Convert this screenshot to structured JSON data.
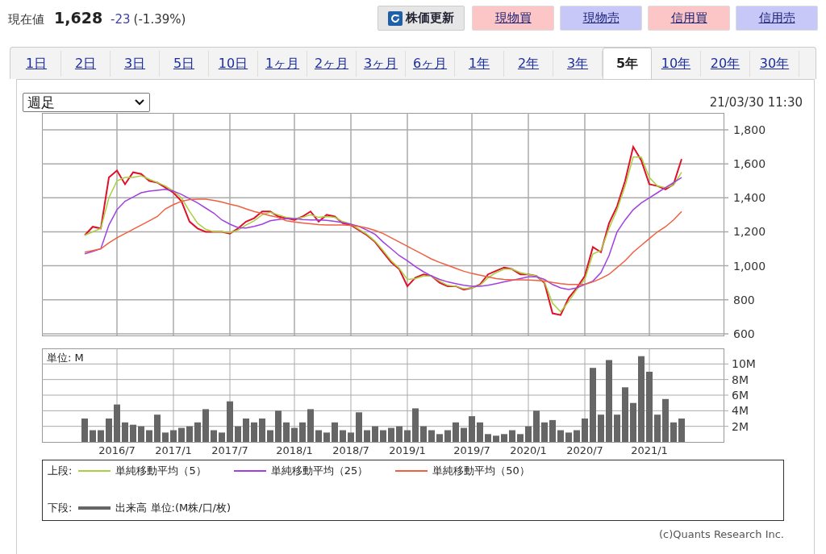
{
  "quote": {
    "label": "現在値",
    "price": "1,628",
    "change": "-23",
    "change_pct": "(-1.39%)"
  },
  "buttons": [
    {
      "label": "株価更新",
      "kind": "refresh",
      "color": "#e6e6e6"
    },
    {
      "label": "現物買",
      "kind": "order",
      "color": "#fdc6c6"
    },
    {
      "label": "現物売",
      "kind": "order",
      "color": "#c8c8f8"
    },
    {
      "label": "信用買",
      "kind": "order",
      "color": "#fdc6c6"
    },
    {
      "label": "信用売",
      "kind": "order",
      "color": "#c8c8f8"
    }
  ],
  "tabs": [
    {
      "label": "1日",
      "selected": false
    },
    {
      "label": "2日",
      "selected": false
    },
    {
      "label": "3日",
      "selected": false
    },
    {
      "label": "5日",
      "selected": false
    },
    {
      "label": "10日",
      "selected": false
    },
    {
      "label": "1ヶ月",
      "selected": false
    },
    {
      "label": "2ヶ月",
      "selected": false
    },
    {
      "label": "3ヶ月",
      "selected": false
    },
    {
      "label": "6ヶ月",
      "selected": false
    },
    {
      "label": "1年",
      "selected": false
    },
    {
      "label": "2年",
      "selected": false
    },
    {
      "label": "3年",
      "selected": false
    },
    {
      "label": "5年",
      "selected": true
    },
    {
      "label": "10年",
      "selected": false
    },
    {
      "label": "20年",
      "selected": false
    },
    {
      "label": "30年",
      "selected": false
    }
  ],
  "chart_panel": {
    "interval": {
      "value": "週足"
    },
    "timestamp": "21/03/30 11:30",
    "price_chart": {
      "chart_data": {
        "type": "line",
        "grid": true,
        "ylim": [
          590,
          1900
        ],
        "yticks": [
          {
            "value": 600,
            "label": "600"
          },
          {
            "value": 800,
            "label": "800"
          },
          {
            "value": 1000,
            "label": "1,000"
          },
          {
            "value": 1200,
            "label": "1,200"
          },
          {
            "value": 1400,
            "label": "1,400"
          },
          {
            "value": 1600,
            "label": "1,600"
          },
          {
            "value": 1800,
            "label": "1,800"
          }
        ],
        "series": [
          {
            "color": "#e0102a",
            "values": [
              1180,
              1230,
              1220,
              1520,
              1560,
              1480,
              1550,
              1540,
              1500,
              1490,
              1460,
              1430,
              1380,
              1260,
              1220,
              1200,
              1200,
              1200,
              1190,
              1220,
              1260,
              1280,
              1320,
              1320,
              1290,
              1280,
              1270,
              1290,
              1320,
              1260,
              1300,
              1290,
              1250,
              1240,
              1210,
              1180,
              1140,
              1080,
              1020,
              980,
              880,
              930,
              950,
              940,
              900,
              880,
              880,
              860,
              870,
              890,
              950,
              970,
              990,
              980,
              950,
              950,
              940,
              900,
              720,
              710,
              810,
              870,
              940,
              1110,
              1080,
              1250,
              1350,
              1500,
              1700,
              1620,
              1480,
              1470,
              1450,
              1480,
              1628
            ]
          },
          {
            "color": "#a8d040",
            "values": [
              1180,
              1200,
              1220,
              1400,
              1500,
              1520,
              1520,
              1530,
              1510,
              1490,
              1470,
              1440,
              1400,
              1320,
              1250,
              1215,
              1200,
              1200,
              1195,
              1210,
              1240,
              1265,
              1300,
              1315,
              1300,
              1285,
              1278,
              1285,
              1300,
              1285,
              1290,
              1285,
              1260,
              1245,
              1215,
              1185,
              1145,
              1090,
              1030,
              985,
              920,
              925,
              940,
              940,
              910,
              885,
              880,
              865,
              870,
              885,
              930,
              960,
              980,
              980,
              960,
              950,
              940,
              905,
              780,
              730,
              790,
              860,
              920,
              1070,
              1090,
              1220,
              1330,
              1470,
              1640,
              1640,
              1520,
              1470,
              1460,
              1475,
              1550
            ]
          },
          {
            "color": "#a040e0",
            "values": [
              1070,
              1085,
              1100,
              1240,
              1330,
              1380,
              1405,
              1430,
              1440,
              1445,
              1450,
              1440,
              1420,
              1395,
              1370,
              1340,
              1310,
              1270,
              1245,
              1225,
              1222,
              1232,
              1245,
              1265,
              1272,
              1278,
              1278,
              1272,
              1270,
              1270,
              1268,
              1262,
              1255,
              1245,
              1232,
              1210,
              1185,
              1140,
              1100,
              1060,
              1030,
              995,
              965,
              940,
              920,
              905,
              895,
              885,
              880,
              880,
              885,
              895,
              905,
              915,
              925,
              935,
              935,
              920,
              890,
              870,
              860,
              870,
              890,
              910,
              960,
              1060,
              1200,
              1270,
              1330,
              1370,
              1400,
              1430,
              1460,
              1490,
              1520
            ]
          },
          {
            "color": "#f06040",
            "values": [
              1080,
              1090,
              1100,
              1135,
              1165,
              1190,
              1215,
              1240,
              1265,
              1290,
              1335,
              1360,
              1380,
              1390,
              1392,
              1392,
              1385,
              1375,
              1362,
              1352,
              1335,
              1320,
              1308,
              1295,
              1285,
              1265,
              1258,
              1252,
              1247,
              1242,
              1240,
              1240,
              1240,
              1238,
              1232,
              1222,
              1208,
              1190,
              1165,
              1140,
              1115,
              1090,
              1065,
              1040,
              1020,
              1003,
              985,
              968,
              955,
              945,
              935,
              925,
              920,
              918,
              918,
              916,
              914,
              910,
              902,
              895,
              890,
              890,
              892,
              905,
              925,
              950,
              990,
              1030,
              1080,
              1120,
              1160,
              1200,
              1230,
              1270,
              1320
            ]
          }
        ]
      }
    },
    "volume_chart": {
      "unit_label": "単位: M",
      "chart_data": {
        "type": "bar",
        "grid": true,
        "ylim": [
          0,
          12
        ],
        "yticks": [
          {
            "value": 2,
            "label": "2M"
          },
          {
            "value": 4,
            "label": "4M"
          },
          {
            "value": 6,
            "label": "6M"
          },
          {
            "value": 8,
            "label": "8M"
          },
          {
            "value": 10,
            "label": "10M"
          }
        ],
        "categories": [
          null,
          null,
          null,
          null,
          "2016/7",
          null,
          null,
          null,
          null,
          null,
          null,
          "2017/1",
          null,
          null,
          null,
          null,
          null,
          null,
          "2017/7",
          null,
          null,
          null,
          null,
          null,
          null,
          null,
          "2018/1",
          null,
          null,
          null,
          null,
          null,
          null,
          "2018/7",
          null,
          null,
          null,
          null,
          null,
          null,
          "2019/1",
          null,
          null,
          null,
          null,
          null,
          null,
          null,
          "2019/7",
          null,
          null,
          null,
          null,
          null,
          null,
          "2020/1",
          null,
          null,
          null,
          null,
          null,
          null,
          "2020/7",
          null,
          null,
          null,
          null,
          null,
          null,
          null,
          "2021/1",
          null,
          null,
          null,
          null
        ],
        "series": [
          {
            "color": "#666666",
            "values": [
              3.0,
              1.5,
              1.5,
              3.0,
              4.8,
              2.5,
              2.2,
              2.0,
              1.5,
              3.5,
              1.2,
              1.5,
              1.8,
              2.0,
              2.5,
              4.2,
              1.5,
              1.2,
              5.2,
              2.0,
              3.0,
              2.5,
              3.0,
              1.5,
              4.0,
              2.5,
              1.8,
              2.5,
              4.2,
              1.5,
              1.2,
              2.5,
              1.5,
              1.2,
              3.8,
              1.5,
              2.0,
              1.5,
              1.8,
              2.0,
              1.5,
              4.3,
              2.0,
              1.5,
              1.0,
              1.5,
              2.5,
              1.8,
              3.3,
              2.5,
              1.0,
              0.8,
              1.0,
              1.5,
              1.0,
              2.0,
              4.0,
              2.5,
              2.8,
              1.5,
              1.2,
              1.5,
              3.0,
              9.5,
              3.5,
              10.5,
              3.5,
              7.0,
              5.0,
              11.0,
              9.0,
              3.5,
              5.5,
              2.5,
              3.0
            ]
          }
        ]
      }
    },
    "legend": {
      "groups": [
        {
          "label": "上段:",
          "items": [
            {
              "text": "単純移動平均（5）",
              "color": "#a8d040"
            },
            {
              "text": "単純移動平均（25）",
              "color": "#a040e0"
            },
            {
              "text": "単純移動平均（50）",
              "color": "#f06040"
            }
          ]
        },
        {
          "label": "下段:",
          "items": [
            {
              "text": "出来高 単位:(M株/口/枚)",
              "color": "#666666"
            }
          ]
        }
      ]
    },
    "copyright": "(c)Quants Research Inc."
  }
}
